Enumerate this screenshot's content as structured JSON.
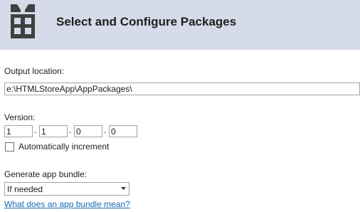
{
  "header": {
    "title": "Select and Configure Packages",
    "icon": "package-gift-icon",
    "background": "#d5dbe8"
  },
  "output": {
    "label": "Output location:",
    "value": "e:\\HTMLStoreApp\\AppPackages\\"
  },
  "version": {
    "label": "Version:",
    "parts": [
      "1",
      "1",
      "0",
      "0"
    ],
    "separator": ".",
    "auto_increment_label": "Automatically increment",
    "auto_increment_checked": false
  },
  "bundle": {
    "label": "Generate app bundle:",
    "selected": "If needed",
    "help_link": "What does an app bundle mean?"
  },
  "colors": {
    "link": "#1a6bb5",
    "border": "#a3a3a3"
  }
}
